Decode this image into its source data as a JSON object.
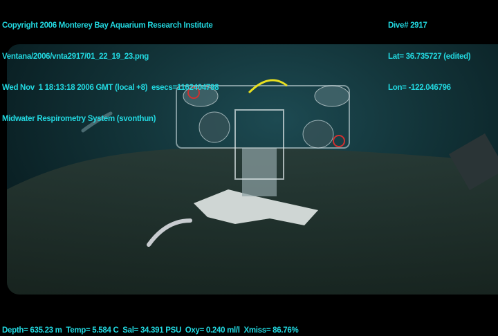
{
  "header_left": [
    "Copyright 2006 Monterey Bay Aquarium Research Institute",
    "Ventana/2006/vnta2917/01_22_19_23.png",
    "Wed Nov  1 18:13:18 2006 GMT (local +8)  esecs=1162404798",
    "Midwater Respirometry System (svonthun)"
  ],
  "header_right": [
    "Dive# 2917",
    "Lat= 36.735727 (edited)",
    "Lon= -122.046796"
  ],
  "footer": "Depth= 635.23 m  Temp= 5.584 C  Sal= 34.391 PSU  Oxy= 0.240 ml/l  Xmiss= 86.76%",
  "colors": {
    "overlay_text": "#22d8e0"
  }
}
